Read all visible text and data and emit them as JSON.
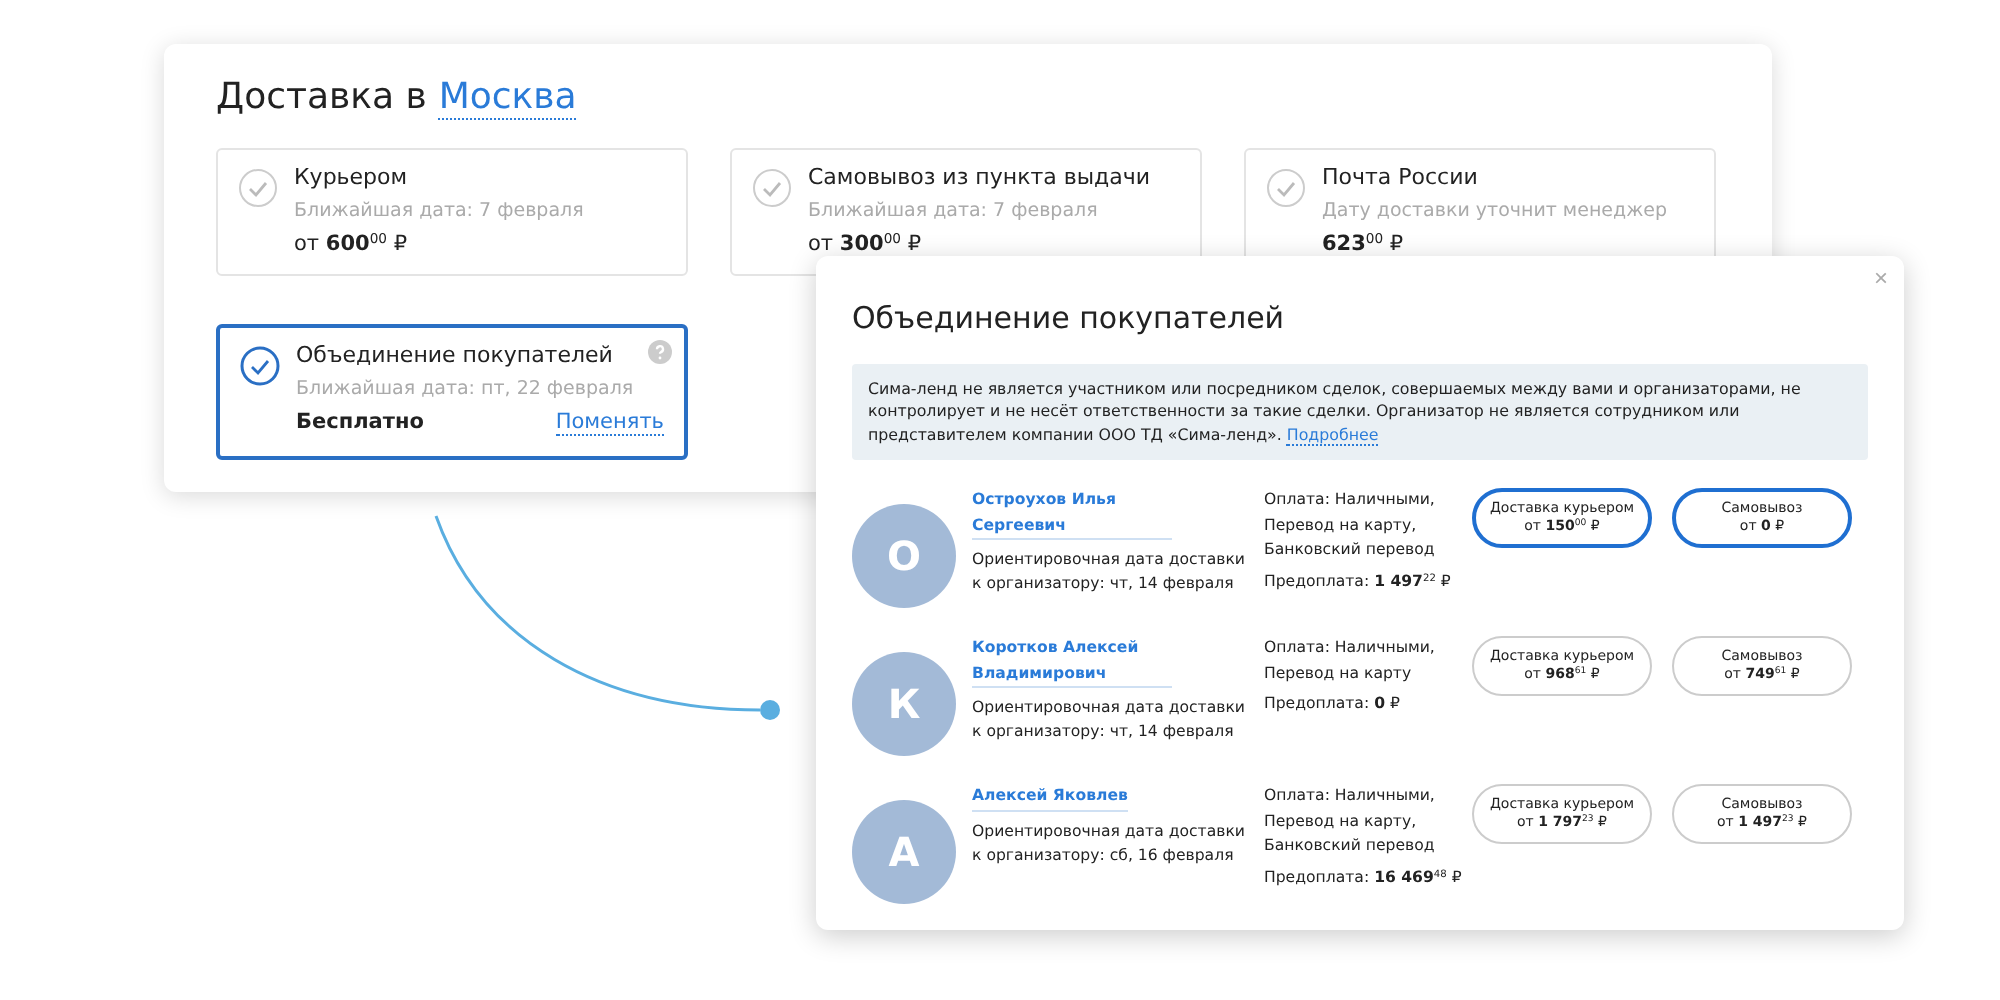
{
  "delivery": {
    "title": "Доставка в",
    "city": "Москва",
    "options": [
      {
        "name": "Курьером",
        "date": "Ближайшая дата: 7 февраля",
        "price": "от **600**$^{00}$ ₽",
        "selected": false
      },
      {
        "name": "Самовывоз из пункта выдачи",
        "date": "Ближайшая дата: 7 февраля",
        "price": "от **300**$^{00}$ ₽",
        "selected": false
      },
      {
        "name": "Почта России",
        "date": "Дату доставки уточнит менеджер",
        "price": "**623**$^{00}$ ₽",
        "selected": false
      },
      {
        "name": "Объединение покупателей",
        "date": "Ближайшая дата: пт, 22 февраля",
        "price": "Бесплатно",
        "action": "Поменять",
        "selected": true
      }
    ]
  },
  "modal": {
    "title": "Объединение покупателей",
    "close": "×",
    "notice": "Сима-ленд не является участником или посредником сделок, совершаемых между вами и организаторами, не контролирует и не несёт ответственности за такие сделки. Организатор не является сотрудником или представителем компании ООО ТД «Сима-ленд».",
    "notice_link": "Подробнее",
    "organizers": [
      {
        "initial": "О",
        "name": "Остроухов Илья Сергеевич",
        "date": "Ориентировочная дата доставки к организатору: чт, 14 февраля",
        "payment": "Оплата: Наличными, Перевод на карту, Банковский перевод",
        "prepay": "Предоплата: **1 497**$^{22}$ ₽",
        "options": [
          {
            "label": "Доставка курьером",
            "price": "от **150**$^{00}$ ₽",
            "selected": true
          },
          {
            "label": "Самовывоз",
            "price": "от **0** ₽",
            "selected": true
          }
        ]
      },
      {
        "initial": "К",
        "name": "Коротков Алексей Владимирович",
        "date": "Ориентировочная дата доставки к организатору: чт, 14 февраля",
        "payment": "Оплата: Наличными, Перевод на карту",
        "prepay": "Предоплата: **0** ₽",
        "options": [
          {
            "label": "Доставка курьером",
            "price": "от **968**$^{61}$ ₽",
            "selected": false
          },
          {
            "label": "Самовывоз",
            "price": "от **749**$^{61}$ ₽",
            "selected": false
          }
        ]
      },
      {
        "initial": "А",
        "name": "Алексей Яковлев",
        "date": "Ориентировочная дата доставки к организатору: сб, 16 февраля",
        "payment": "Оплата: Наличными, Перевод на карту, Банковский перевод",
        "prepay": "Предоплата: **16 469**$^{48}$ ₽",
        "options": [
          {
            "label": "Доставка курьером",
            "price": "от **1 797**$^{23}$ ₽",
            "selected": false
          },
          {
            "label": "Самовывоз",
            "price": "от **1 497**$^{23}$ ₽",
            "selected": false
          }
        ]
      }
    ]
  }
}
